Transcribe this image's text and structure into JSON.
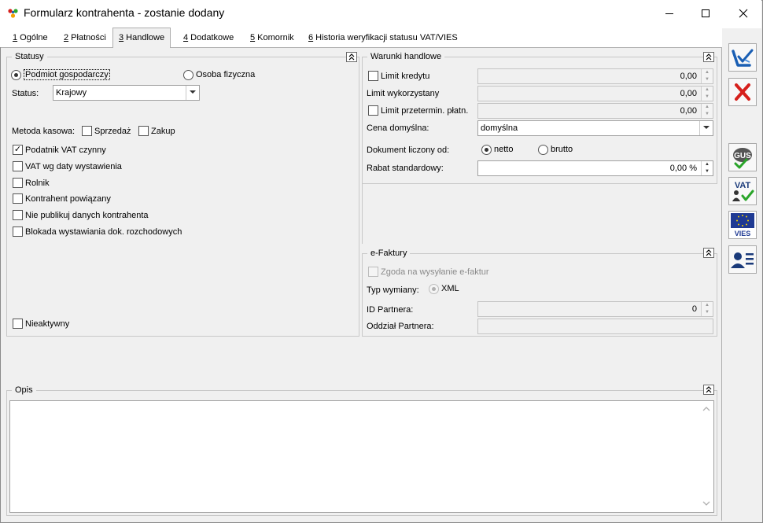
{
  "window": {
    "title": "Formularz kontrahenta - zostanie dodany"
  },
  "tabs": [
    {
      "key": "1",
      "label": " Ogólne"
    },
    {
      "key": "2",
      "label": " Płatności"
    },
    {
      "key": "3",
      "label": " Handlowe"
    },
    {
      "key": "4",
      "label": " Dodatkowe"
    },
    {
      "key": "5",
      "label": " Komornik"
    },
    {
      "key": "6",
      "label": " Historia weryfikacji statusu VAT/VIES"
    }
  ],
  "statusy": {
    "title": "Statusy",
    "podmiot_label": "Podmiot gospodarczy",
    "osoba_label": "Osoba fizyczna",
    "status_label": "Status:",
    "status_value": "Krajowy",
    "metoda_label": "Metoda kasowa:",
    "sprzedaz_label": "Sprzedaż",
    "zakup_label": "Zakup",
    "checkboxes": [
      {
        "label": "Podatnik VAT czynny",
        "checked": "✓"
      },
      {
        "label": "VAT wg daty wystawienia",
        "checked": ""
      },
      {
        "label": "Rolnik",
        "checked": ""
      },
      {
        "label": "Kontrahent powiązany",
        "checked": ""
      },
      {
        "label": "Nie publikuj danych kontrahenta",
        "checked": ""
      },
      {
        "label": "Blokada wystawiania dok. rozchodowych",
        "checked": ""
      }
    ],
    "nieaktywny_label": "Nieaktywny"
  },
  "warunki": {
    "title": "Warunki handlowe",
    "limit_kredytu_label": "Limit kredytu",
    "limit_kredytu_value": "0,00",
    "limit_wykorzystany_label": "Limit wykorzystany",
    "limit_wykorzystany_value": "0,00",
    "limit_przeterm_label": "Limit przetermin. płatn.",
    "limit_przeterm_value": "0,00",
    "cena_label": "Cena domyślna:",
    "cena_value": "domyślna",
    "dokument_label": "Dokument liczony od:",
    "netto_label": "netto",
    "brutto_label": "brutto",
    "rabat_label": "Rabat standardowy:",
    "rabat_value": "0,00 %"
  },
  "efaktury": {
    "title": "e-Faktury",
    "zgoda_label": "Zgoda na wysyłanie e-faktur",
    "typ_label": "Typ wymiany:",
    "xml_label": "XML",
    "id_label": "ID Partnera:",
    "id_value": "0",
    "oddzial_label": "Oddział Partnera:",
    "oddzial_value": ""
  },
  "opis": {
    "title": "Opis",
    "value": ""
  },
  "sidebar": {
    "save": "save-icon",
    "cancel": "cancel-icon",
    "gus": "GUS",
    "vat": "VAT",
    "vies": "VIES",
    "contact": "contact-card-icon"
  },
  "colors": {
    "accent_blue": "#1a5fb4",
    "cancel_red": "#d6201c",
    "check_green": "#2aa52a"
  }
}
